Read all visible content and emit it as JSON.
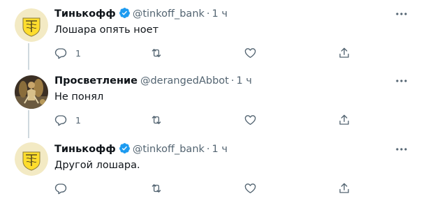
{
  "tweets": [
    {
      "author": "Тинькофф",
      "handle": "@tinkoff_bank",
      "separator": "·",
      "time": "1 ч",
      "text": "Лошара опять ноет",
      "verified": true,
      "avatar_icon": "tinkoff-emblem-icon",
      "reply_count": "1",
      "retweet_count": "",
      "like_count": ""
    },
    {
      "author": "Просветление",
      "handle": "@derangedAbbot",
      "separator": "·",
      "time": "1 ч",
      "text": "Не понял",
      "verified": false,
      "avatar_icon": "user-photo-avatar",
      "reply_count": "1",
      "retweet_count": "",
      "like_count": ""
    },
    {
      "author": "Тинькофф",
      "handle": "@tinkoff_bank",
      "separator": "·",
      "time": "1 ч",
      "text": "Другой лошара.",
      "verified": true,
      "avatar_icon": "tinkoff-emblem-icon",
      "reply_count": "",
      "retweet_count": "",
      "like_count": ""
    }
  ],
  "colors": {
    "text": "#0f1419",
    "secondary": "#536471",
    "verified": "#1d9bf0",
    "thread_line": "#cfd9de",
    "tinkoff_yellow": "#ffdd2d"
  }
}
